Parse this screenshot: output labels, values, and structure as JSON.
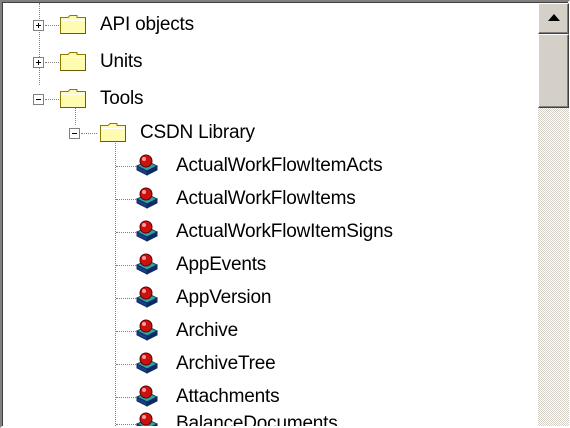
{
  "tree": {
    "nodes": [
      {
        "label": "API objects",
        "icon": "folder-icon",
        "expander": "plus"
      },
      {
        "label": "Units",
        "icon": "folder-icon",
        "expander": "plus"
      },
      {
        "label": "Tools",
        "icon": "folder-icon",
        "expander": "minus"
      },
      {
        "label": "CSDN Library",
        "icon": "folder-icon",
        "expander": "minus"
      },
      {
        "label": "ActualWorkFlowItemActs",
        "icon": "database-table-icon"
      },
      {
        "label": "ActualWorkFlowItems",
        "icon": "database-table-icon"
      },
      {
        "label": "ActualWorkFlowItemSigns",
        "icon": "database-table-icon"
      },
      {
        "label": "AppEvents",
        "icon": "database-table-icon"
      },
      {
        "label": "AppVersion",
        "icon": "database-table-icon"
      },
      {
        "label": "Archive",
        "icon": "database-table-icon"
      },
      {
        "label": "ArchiveTree",
        "icon": "database-table-icon"
      },
      {
        "label": "Attachments",
        "icon": "database-table-icon"
      },
      {
        "label": "BalanceDocuments",
        "icon": "database-table-icon"
      }
    ]
  },
  "colors": {
    "folder_fill": "#fffbb0",
    "folder_stroke": "#8a7b00",
    "window_bg": "#ffffff",
    "chrome": "#d4d0c8"
  }
}
